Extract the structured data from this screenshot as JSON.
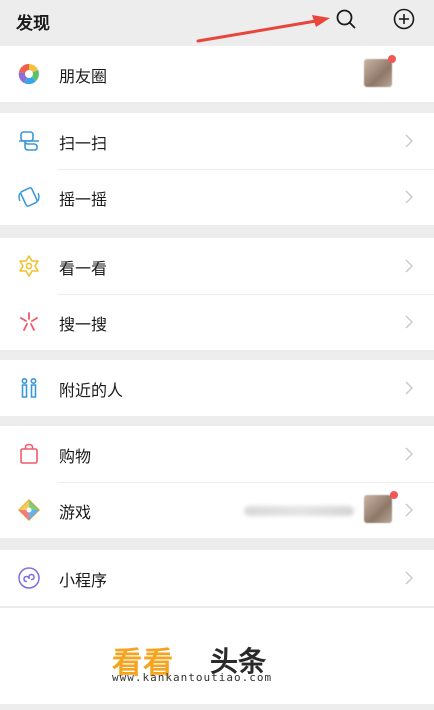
{
  "header": {
    "title": "发现"
  },
  "groups": [
    {
      "items": [
        {
          "label": "朋友圈"
        }
      ]
    },
    {
      "items": [
        {
          "label": "扫一扫"
        },
        {
          "label": "摇一摇"
        }
      ]
    },
    {
      "items": [
        {
          "label": "看一看"
        },
        {
          "label": "搜一搜"
        }
      ]
    },
    {
      "items": [
        {
          "label": "附近的人"
        }
      ]
    },
    {
      "items": [
        {
          "label": "购物"
        },
        {
          "label": "游戏"
        }
      ]
    },
    {
      "items": [
        {
          "label": "小程序"
        }
      ]
    }
  ],
  "watermark": {
    "main": "看看",
    "sub": "头条",
    "url": "www.kankantoutiao.com"
  },
  "colors": {
    "accent_red": "#f25656",
    "background": "#ededed",
    "watermark_orange": "#f5a41f"
  }
}
